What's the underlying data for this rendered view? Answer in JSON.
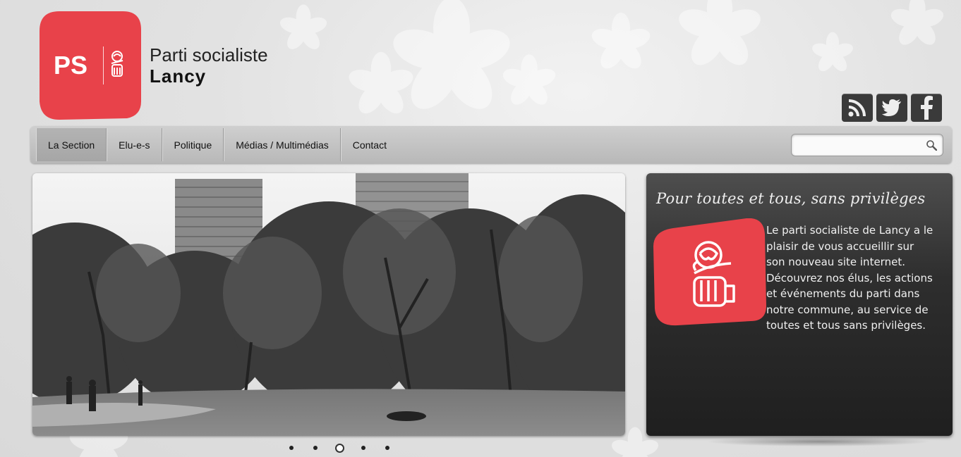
{
  "brand": {
    "logo_text": "PS",
    "site_name": "Parti socialiste",
    "site_sub": "Lancy",
    "logo_color": "#e8424a"
  },
  "social": [
    "rss-icon",
    "twitter-icon",
    "facebook-icon"
  ],
  "nav": {
    "items": [
      {
        "label": "La Section",
        "active": true
      },
      {
        "label": "Elu-e-s"
      },
      {
        "label": "Politique"
      },
      {
        "label": "Médias / Multimédias"
      },
      {
        "label": "Contact"
      }
    ],
    "search_placeholder": ""
  },
  "slider": {
    "slide_count": 5,
    "active_index": 2
  },
  "panel": {
    "title": "Pour toutes et tous, sans privilèges",
    "text": "Le parti socialiste de Lancy a le plaisir de vous accueillir sur son nouveau site internet. Découvrez nos élus, les actions et événements du parti dans notre commune, au service de toutes et tous sans privilèges."
  }
}
